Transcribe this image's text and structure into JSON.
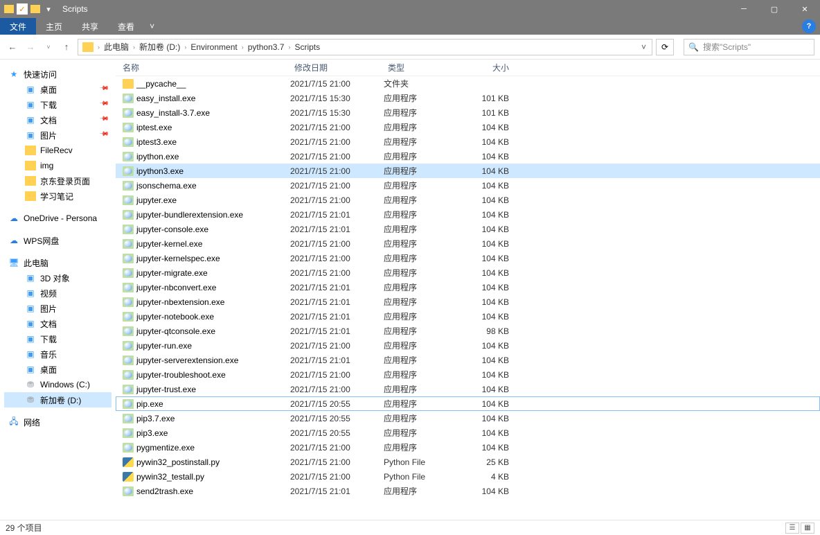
{
  "title": "Scripts",
  "ribbon": {
    "file": "文件",
    "home": "主页",
    "share": "共享",
    "view": "查看"
  },
  "crumbs": [
    "此电脑",
    "新加卷 (D:)",
    "Environment",
    "python3.7",
    "Scripts"
  ],
  "search_placeholder": "搜索\"Scripts\"",
  "columns": {
    "name": "名称",
    "date": "修改日期",
    "type": "类型",
    "size": "大小"
  },
  "sidebar": {
    "quick": {
      "label": "快速访问",
      "items": [
        {
          "label": "桌面",
          "pin": true,
          "ico": "mon"
        },
        {
          "label": "下载",
          "pin": true,
          "ico": "mon"
        },
        {
          "label": "文档",
          "pin": true,
          "ico": "mon"
        },
        {
          "label": "图片",
          "pin": true,
          "ico": "mon"
        },
        {
          "label": "FileRecv",
          "pin": false,
          "ico": "folder"
        },
        {
          "label": "img",
          "pin": false,
          "ico": "folder"
        },
        {
          "label": "京东登录页面",
          "pin": false,
          "ico": "folder"
        },
        {
          "label": "学习笔记",
          "pin": false,
          "ico": "folder"
        }
      ]
    },
    "onedrive": "OneDrive - Persona",
    "wps": "WPS网盘",
    "thispc": {
      "label": "此电脑",
      "items": [
        {
          "label": "3D 对象",
          "ico": "mon"
        },
        {
          "label": "视频",
          "ico": "mon"
        },
        {
          "label": "图片",
          "ico": "mon"
        },
        {
          "label": "文档",
          "ico": "mon"
        },
        {
          "label": "下载",
          "ico": "mon"
        },
        {
          "label": "音乐",
          "ico": "mon"
        },
        {
          "label": "桌面",
          "ico": "mon"
        },
        {
          "label": "Windows (C:)",
          "ico": "disk"
        },
        {
          "label": "新加卷 (D:)",
          "ico": "disk",
          "sel": true
        }
      ]
    },
    "network": "网络"
  },
  "files": [
    {
      "name": "__pycache__",
      "date": "2021/7/15 21:00",
      "type": "文件夹",
      "size": "",
      "ico": "folder"
    },
    {
      "name": "easy_install.exe",
      "date": "2021/7/15 15:30",
      "type": "应用程序",
      "size": "101 KB",
      "ico": "exe"
    },
    {
      "name": "easy_install-3.7.exe",
      "date": "2021/7/15 15:30",
      "type": "应用程序",
      "size": "101 KB",
      "ico": "exe"
    },
    {
      "name": "iptest.exe",
      "date": "2021/7/15 21:00",
      "type": "应用程序",
      "size": "104 KB",
      "ico": "exe"
    },
    {
      "name": "iptest3.exe",
      "date": "2021/7/15 21:00",
      "type": "应用程序",
      "size": "104 KB",
      "ico": "exe"
    },
    {
      "name": "ipython.exe",
      "date": "2021/7/15 21:00",
      "type": "应用程序",
      "size": "104 KB",
      "ico": "exe"
    },
    {
      "name": "ipython3.exe",
      "date": "2021/7/15 21:00",
      "type": "应用程序",
      "size": "104 KB",
      "ico": "exe",
      "hl": true
    },
    {
      "name": "jsonschema.exe",
      "date": "2021/7/15 21:00",
      "type": "应用程序",
      "size": "104 KB",
      "ico": "exe"
    },
    {
      "name": "jupyter.exe",
      "date": "2021/7/15 21:00",
      "type": "应用程序",
      "size": "104 KB",
      "ico": "exe"
    },
    {
      "name": "jupyter-bundlerextension.exe",
      "date": "2021/7/15 21:01",
      "type": "应用程序",
      "size": "104 KB",
      "ico": "exe"
    },
    {
      "name": "jupyter-console.exe",
      "date": "2021/7/15 21:01",
      "type": "应用程序",
      "size": "104 KB",
      "ico": "exe"
    },
    {
      "name": "jupyter-kernel.exe",
      "date": "2021/7/15 21:00",
      "type": "应用程序",
      "size": "104 KB",
      "ico": "exe"
    },
    {
      "name": "jupyter-kernelspec.exe",
      "date": "2021/7/15 21:00",
      "type": "应用程序",
      "size": "104 KB",
      "ico": "exe"
    },
    {
      "name": "jupyter-migrate.exe",
      "date": "2021/7/15 21:00",
      "type": "应用程序",
      "size": "104 KB",
      "ico": "exe"
    },
    {
      "name": "jupyter-nbconvert.exe",
      "date": "2021/7/15 21:01",
      "type": "应用程序",
      "size": "104 KB",
      "ico": "exe"
    },
    {
      "name": "jupyter-nbextension.exe",
      "date": "2021/7/15 21:01",
      "type": "应用程序",
      "size": "104 KB",
      "ico": "exe"
    },
    {
      "name": "jupyter-notebook.exe",
      "date": "2021/7/15 21:01",
      "type": "应用程序",
      "size": "104 KB",
      "ico": "exe"
    },
    {
      "name": "jupyter-qtconsole.exe",
      "date": "2021/7/15 21:01",
      "type": "应用程序",
      "size": "98 KB",
      "ico": "exe"
    },
    {
      "name": "jupyter-run.exe",
      "date": "2021/7/15 21:00",
      "type": "应用程序",
      "size": "104 KB",
      "ico": "exe"
    },
    {
      "name": "jupyter-serverextension.exe",
      "date": "2021/7/15 21:01",
      "type": "应用程序",
      "size": "104 KB",
      "ico": "exe"
    },
    {
      "name": "jupyter-troubleshoot.exe",
      "date": "2021/7/15 21:00",
      "type": "应用程序",
      "size": "104 KB",
      "ico": "exe"
    },
    {
      "name": "jupyter-trust.exe",
      "date": "2021/7/15 21:00",
      "type": "应用程序",
      "size": "104 KB",
      "ico": "exe"
    },
    {
      "name": "pip.exe",
      "date": "2021/7/15 20:55",
      "type": "应用程序",
      "size": "104 KB",
      "ico": "exe",
      "focus": true
    },
    {
      "name": "pip3.7.exe",
      "date": "2021/7/15 20:55",
      "type": "应用程序",
      "size": "104 KB",
      "ico": "exe"
    },
    {
      "name": "pip3.exe",
      "date": "2021/7/15 20:55",
      "type": "应用程序",
      "size": "104 KB",
      "ico": "exe"
    },
    {
      "name": "pygmentize.exe",
      "date": "2021/7/15 21:00",
      "type": "应用程序",
      "size": "104 KB",
      "ico": "exe"
    },
    {
      "name": "pywin32_postinstall.py",
      "date": "2021/7/15 21:00",
      "type": "Python File",
      "size": "25 KB",
      "ico": "py"
    },
    {
      "name": "pywin32_testall.py",
      "date": "2021/7/15 21:00",
      "type": "Python File",
      "size": "4 KB",
      "ico": "py"
    },
    {
      "name": "send2trash.exe",
      "date": "2021/7/15 21:01",
      "type": "应用程序",
      "size": "104 KB",
      "ico": "exe"
    }
  ],
  "status": "29 个项目"
}
